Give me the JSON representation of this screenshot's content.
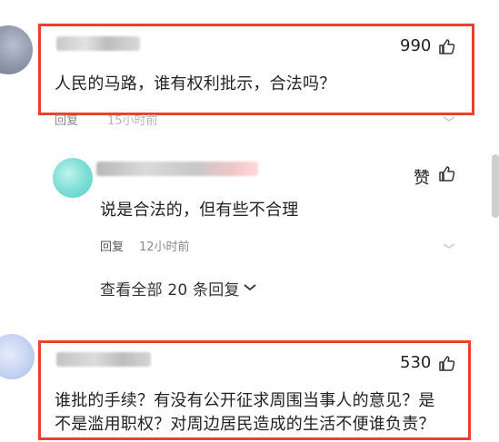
{
  "comment1": {
    "likes": "990",
    "text": "人民的马路，谁有权利批示，合法吗？",
    "reply_label": "回复",
    "time": "15小时前"
  },
  "reply1": {
    "like_label": "赞",
    "text": "说是合法的，但有些不合理",
    "reply_label": "回复",
    "time": "12小时前"
  },
  "view_all_replies": "查看全部 20 条回复",
  "comment2": {
    "likes": "530",
    "text_line1": "谁批的手续？有没有公开征求周围当事人的意见？是",
    "text_line2": "不是滥用职权？对周边居民造成的生活不便谁负责？"
  },
  "colors": {
    "highlight_border": "#e8412e"
  }
}
